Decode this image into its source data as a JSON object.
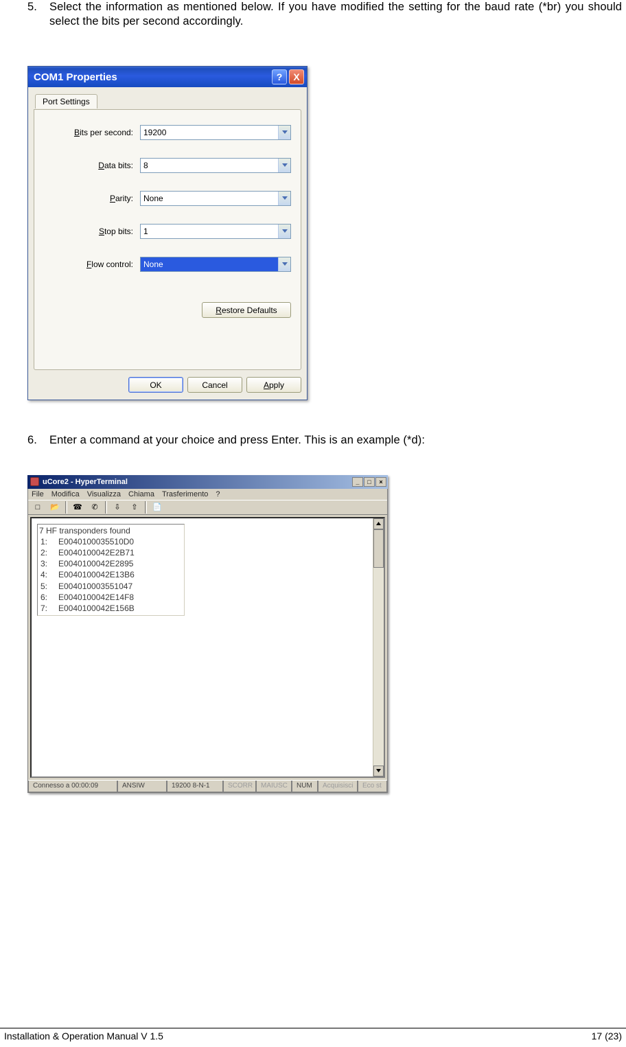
{
  "instructions": {
    "step5": {
      "num": "5.",
      "text": "Select the information as mentioned below. If you have modified the setting for the baud rate (*br) you should select the bits per second accordingly."
    },
    "step6": {
      "num": "6.",
      "text": "Enter a command at your choice and press Enter. This is an example (*d):"
    }
  },
  "dialog": {
    "title": "COM1 Properties",
    "help_char": "?",
    "close_char": "X",
    "tab": "Port Settings",
    "fields": {
      "bits_per_second": {
        "prefix": "B",
        "rest": "its per second:",
        "value": "19200"
      },
      "data_bits": {
        "prefix": "D",
        "rest": "ata bits:",
        "value": "8"
      },
      "parity": {
        "prefix": "P",
        "rest": "arity:",
        "value": "None"
      },
      "stop_bits": {
        "prefix": "S",
        "rest": "top bits:",
        "value": "1"
      },
      "flow_control": {
        "prefix": "F",
        "rest": "low control:",
        "value": "None"
      }
    },
    "restore_prefix": "R",
    "restore_rest": "estore Defaults",
    "ok": "OK",
    "cancel": "Cancel",
    "apply_prefix": "A",
    "apply_rest": "pply"
  },
  "terminal": {
    "title": "uCore2 - HyperTerminal",
    "menus": [
      "File",
      "Modifica",
      "Visualizza",
      "Chiama",
      "Trasferimento",
      "?"
    ],
    "found_line": "7 HF transponders found",
    "rows": [
      {
        "idx": "1:",
        "val": "E0040100035510D0"
      },
      {
        "idx": "2:",
        "val": "E0040100042E2B71"
      },
      {
        "idx": "3:",
        "val": "E0040100042E2895"
      },
      {
        "idx": "4:",
        "val": "E0040100042E13B6"
      },
      {
        "idx": "5:",
        "val": "E004010003551047"
      },
      {
        "idx": "6:",
        "val": "E0040100042E14F8"
      },
      {
        "idx": "7:",
        "val": "E0040100042E156B"
      }
    ],
    "status": {
      "conn": "Connesso a 00:00:09",
      "emul": "ANSIW",
      "params": "19200 8-N-1",
      "scorr": "SCORR",
      "maiusc": "MAIUSC",
      "num": "NUM",
      "acq": "Acquisisci",
      "eco": "Eco st"
    }
  },
  "footer": {
    "left": "Installation & Operation Manual V 1.5",
    "right": "17 (23)"
  }
}
